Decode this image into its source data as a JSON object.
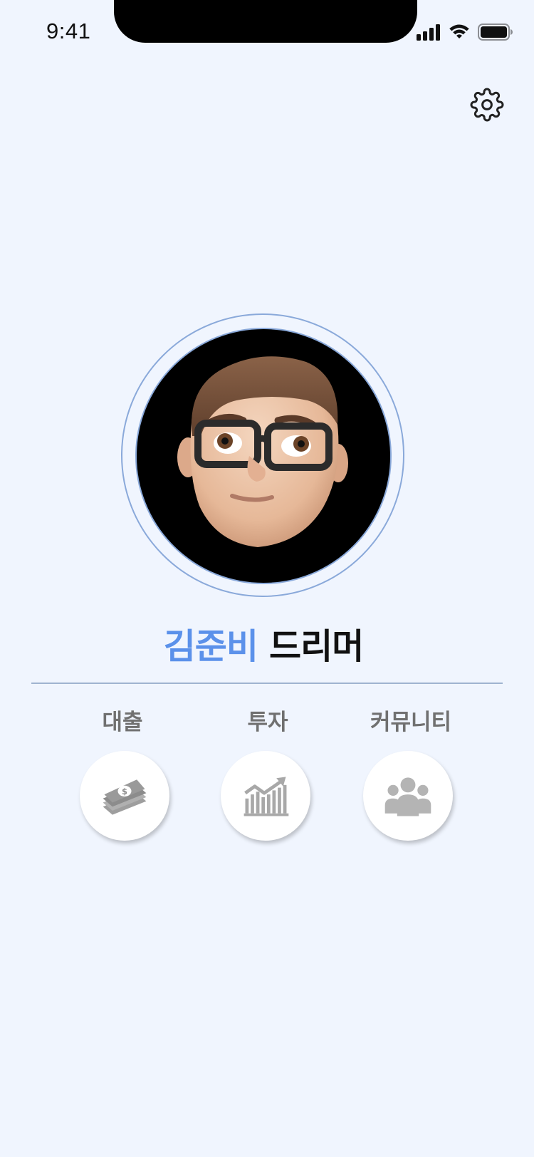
{
  "status_bar": {
    "time": "9:41",
    "icons": [
      "cellular-signal-icon",
      "wifi-icon",
      "battery-icon"
    ]
  },
  "header": {
    "settings_icon": "gear-icon"
  },
  "profile": {
    "avatar": "memoji-avatar",
    "name": "김준비",
    "title": "드리머",
    "accent_color": "#5b91ea"
  },
  "menu": {
    "items": [
      {
        "label": "대출",
        "icon": "money-stack-icon"
      },
      {
        "label": "투자",
        "icon": "investment-chart-icon"
      },
      {
        "label": "커뮤니티",
        "icon": "people-group-icon"
      }
    ]
  },
  "colors": {
    "background": "#f0f5fe",
    "ring": "#8aa9da",
    "label": "#707070",
    "icon": "#a8a8a8"
  }
}
